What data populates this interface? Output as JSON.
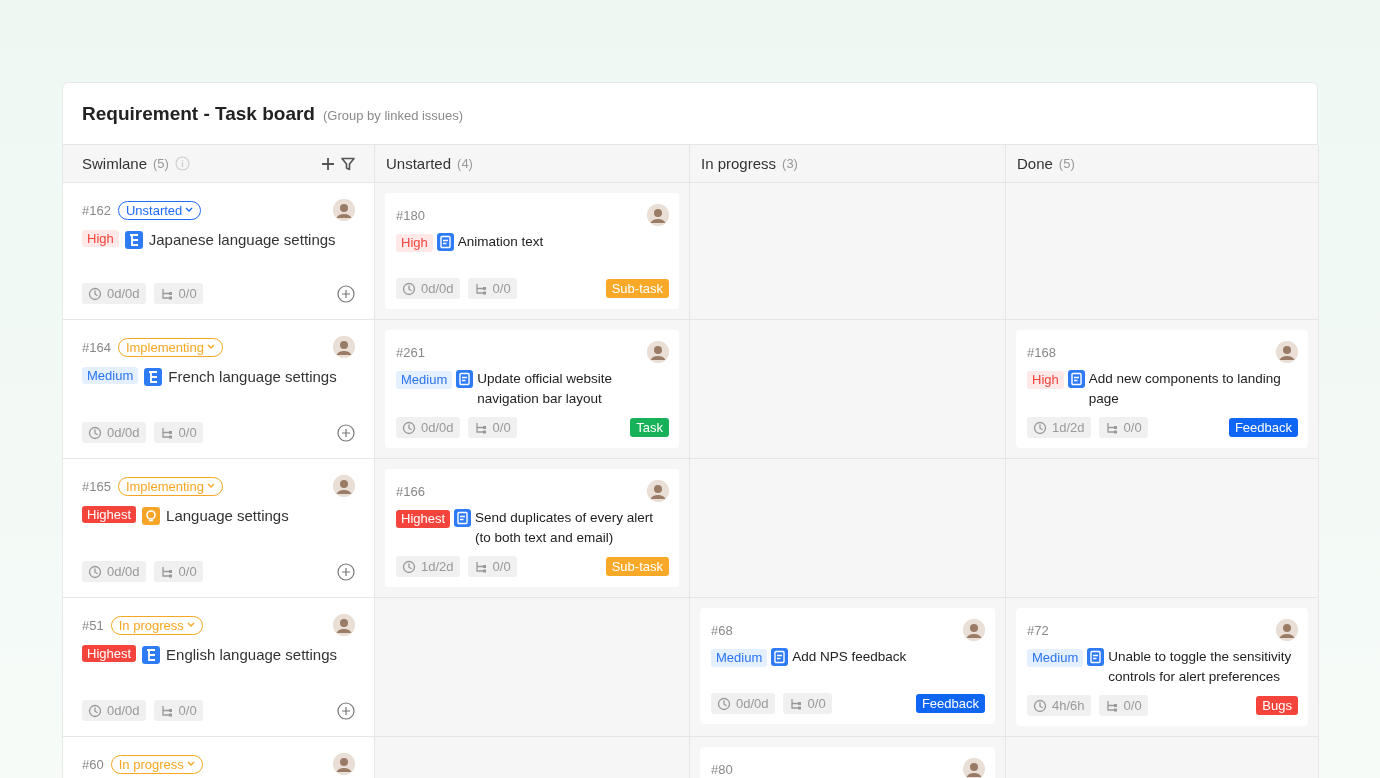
{
  "board": {
    "title": "Requirement - Task board",
    "subtitle": "(Group by linked issues)"
  },
  "columns": [
    {
      "label": "Swimlane",
      "count": "(5)"
    },
    {
      "label": "Unstarted",
      "count": "(4)"
    },
    {
      "label": "In progress",
      "count": "(3)"
    },
    {
      "label": "Done",
      "count": "(5)"
    }
  ],
  "swimlanes": [
    {
      "id": "#162",
      "status": {
        "label": "Unstarted",
        "kind": "unstarted"
      },
      "priority": {
        "label": "High",
        "kind": "high"
      },
      "kind": "subtask",
      "title": "Japanese language  settings",
      "time": "0d/0d",
      "subtasks": "0/0",
      "cells": [
        [
          {
            "id": "#180",
            "priority": {
              "label": "High",
              "kind": "high"
            },
            "title": "Animation text",
            "time": "0d/0d",
            "subtasks": "0/0",
            "tag": {
              "label": "Sub-task",
              "kind": "subtask"
            }
          }
        ],
        [],
        []
      ]
    },
    {
      "id": "#164",
      "status": {
        "label": "Implementing",
        "kind": "implementing"
      },
      "priority": {
        "label": "Medium",
        "kind": "medium"
      },
      "kind": "subtask",
      "title": "French language settings",
      "time": "0d/0d",
      "subtasks": "0/0",
      "cells": [
        [
          {
            "id": "#261",
            "priority": {
              "label": "Medium",
              "kind": "medium"
            },
            "title": "Update official website navigation bar layout",
            "time": "0d/0d",
            "subtasks": "0/0",
            "tag": {
              "label": "Task",
              "kind": "task"
            }
          }
        ],
        [],
        [
          {
            "id": "#168",
            "priority": {
              "label": "High",
              "kind": "high"
            },
            "title": "Add new components to landing page",
            "time": "1d/2d",
            "subtasks": "0/0",
            "tag": {
              "label": "Feedback",
              "kind": "feedback"
            }
          }
        ]
      ]
    },
    {
      "id": "#165",
      "status": {
        "label": "Implementing",
        "kind": "implementing"
      },
      "priority": {
        "label": "Highest",
        "kind": "highest"
      },
      "kind": "idea",
      "title": "Language settings",
      "time": "0d/0d",
      "subtasks": "0/0",
      "cells": [
        [
          {
            "id": "#166",
            "priority": {
              "label": "Highest",
              "kind": "highest"
            },
            "title": "Send duplicates of every alert (to both text and email)",
            "time": "1d/2d",
            "subtasks": "0/0",
            "tag": {
              "label": "Sub-task",
              "kind": "subtask"
            }
          }
        ],
        [],
        []
      ]
    },
    {
      "id": "#51",
      "status": {
        "label": "In progress",
        "kind": "in-progress"
      },
      "priority": {
        "label": "Highest",
        "kind": "highest"
      },
      "kind": "subtask",
      "title": "English language settings",
      "time": "0d/0d",
      "subtasks": "0/0",
      "cells": [
        [],
        [
          {
            "id": "#68",
            "priority": {
              "label": "Medium",
              "kind": "medium"
            },
            "title": "Add NPS feedback",
            "time": "0d/0d",
            "subtasks": "0/0",
            "tag": {
              "label": "Feedback",
              "kind": "feedback"
            }
          }
        ],
        [
          {
            "id": "#72",
            "priority": {
              "label": "Medium",
              "kind": "medium"
            },
            "title": "Unable to toggle the sensitivity controls for alert preferences",
            "time": "4h/6h",
            "subtasks": "0/0",
            "tag": {
              "label": "Bugs",
              "kind": "bugs"
            }
          }
        ]
      ]
    },
    {
      "id": "#60",
      "status": {
        "label": "In progress",
        "kind": "in-progress"
      },
      "cells": [
        [],
        [
          {
            "id": "#80"
          }
        ],
        []
      ]
    }
  ]
}
